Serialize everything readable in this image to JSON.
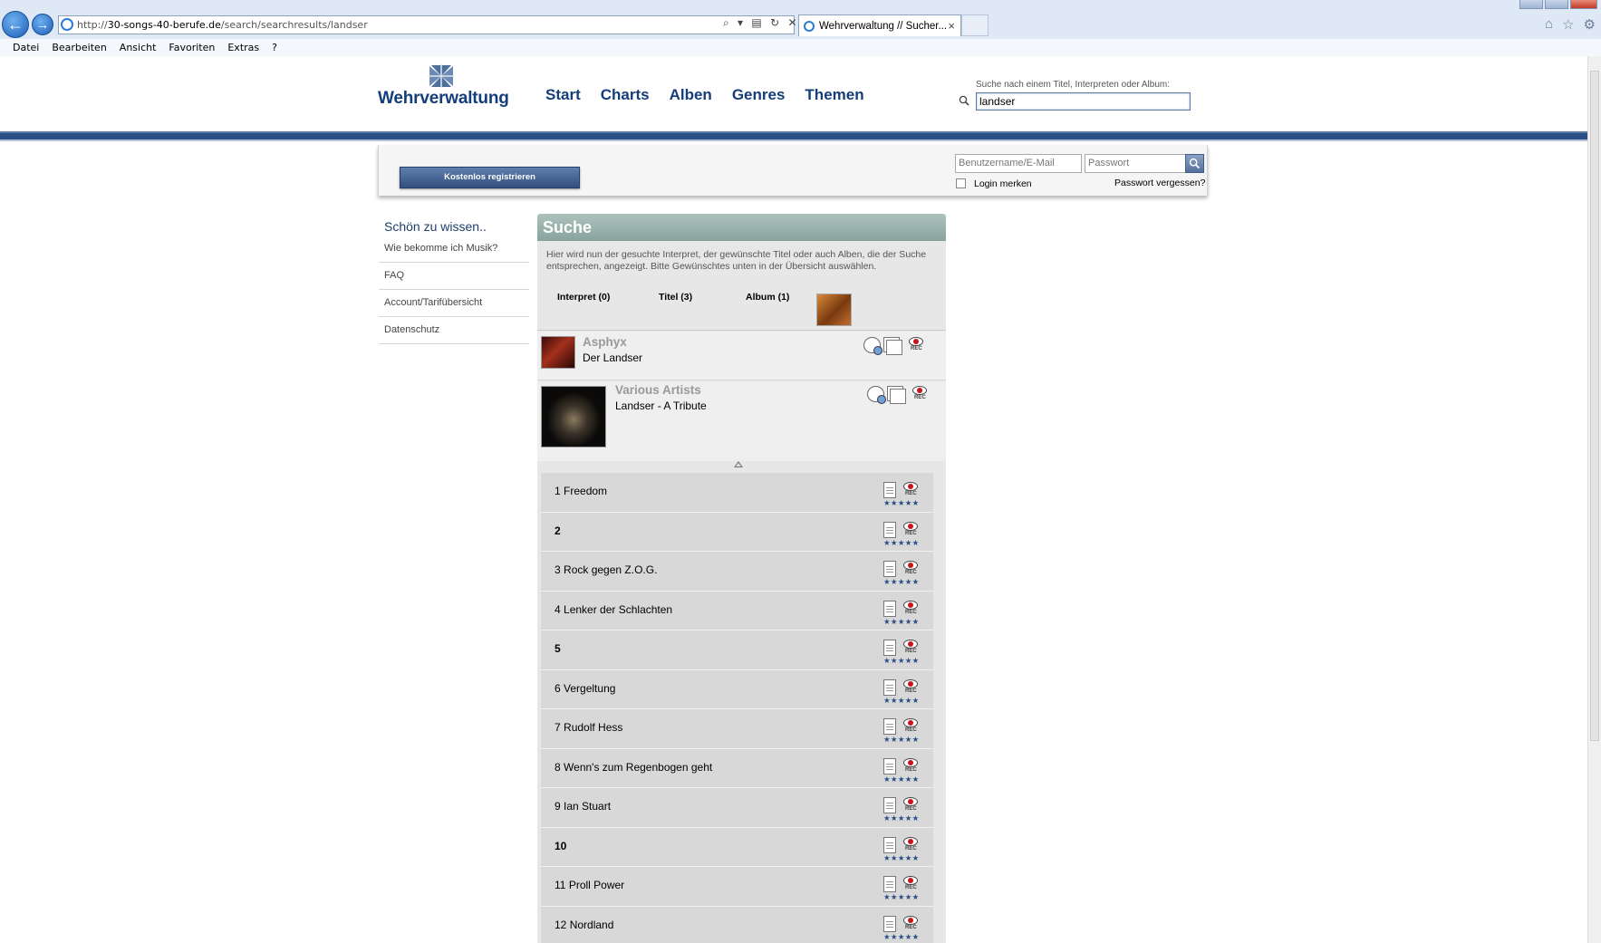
{
  "browser": {
    "url_prefix": "http://",
    "url_host": "30-songs-40-berufe.de",
    "url_path": "/search/searchresults/landser",
    "tab_title": "Wehrverwaltung // Sucher...",
    "tab_close": "×",
    "back_arrow": "←",
    "forward_arrow": "→",
    "addr_tools": "⌕ ▾ ▤ ↻ ✕",
    "menu": [
      "Datei",
      "Bearbeiten",
      "Ansicht",
      "Favoriten",
      "Extras",
      "?"
    ],
    "icons": [
      "home-icon",
      "star-icon",
      "gear-icon"
    ],
    "icon_glyphs": {
      "home": "⌂",
      "star": "☆",
      "gear": "⚙"
    }
  },
  "header": {
    "logo_text": "Wehrverwaltung",
    "nav": [
      "Start",
      "Charts",
      "Alben",
      "Genres",
      "Themen"
    ],
    "search_label": "Suche nach einem Titel, Interpreten oder Album:",
    "search_value": "landser"
  },
  "login": {
    "register_label": "Kostenlos registrieren",
    "user_placeholder": "Benutzername/E-Mail",
    "pass_placeholder": "Passwort",
    "remember_label": "Login merken",
    "forgot_label": "Passwort vergessen?"
  },
  "sidebar": {
    "title": "Schön zu wissen..",
    "items": [
      "Wie bekomme ich Musik?",
      "FAQ",
      "Account/Tarifübersicht",
      "Datenschutz"
    ]
  },
  "main": {
    "heading": "Suche",
    "description": "Hier wird nun der gesuchte Interpret, der gewünschte Titel oder auch Alben, die der Suche entsprechen, angezeigt. Bitte Gewünschtes unten in der Übersicht auswählen.",
    "tabs": [
      "Interpret (0)",
      "Titel (3)",
      "Album (1)"
    ],
    "results": [
      {
        "artist": "Asphyx",
        "album": "Der Landser"
      },
      {
        "artist": "Various Artists",
        "album": "Landser - A Tribute"
      }
    ],
    "rec_label": "REC",
    "rating_stars": "★★★★★",
    "tracks": [
      {
        "num": "1",
        "title": "Freedom"
      },
      {
        "num": "2",
        "title": ""
      },
      {
        "num": "3",
        "title": "Rock gegen Z.O.G."
      },
      {
        "num": "4",
        "title": "Lenker der Schlachten"
      },
      {
        "num": "5",
        "title": ""
      },
      {
        "num": "6",
        "title": "Vergeltung"
      },
      {
        "num": "7",
        "title": "Rudolf Hess"
      },
      {
        "num": "8",
        "title": "Wenn's zum Regenbogen geht"
      },
      {
        "num": "9",
        "title": "Ian Stuart"
      },
      {
        "num": "10",
        "title": ""
      },
      {
        "num": "11",
        "title": "Proll Power"
      },
      {
        "num": "12",
        "title": "Nordland"
      }
    ]
  },
  "colors": {
    "brand_blue": "#143d7a",
    "header_bar": "#2a4f86",
    "suche_head": "#9fb6b1",
    "rec_red": "#c4161c"
  }
}
